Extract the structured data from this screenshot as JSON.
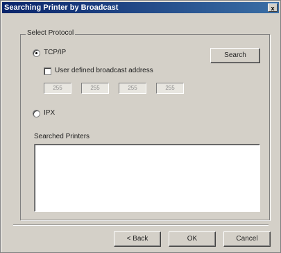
{
  "window": {
    "title": "Searching Printer by Broadcast",
    "close_glyph": "x"
  },
  "protocol_group": {
    "label": "Select Protocol",
    "tcpip": {
      "label": "TCP/IP",
      "selected": true
    },
    "user_defined": {
      "label": "User defined broadcast address",
      "checked": false
    },
    "ip_fields": [
      "255",
      "255",
      "255",
      "255"
    ],
    "ipx": {
      "label": "IPX",
      "selected": false
    }
  },
  "buttons": {
    "search": "Search",
    "back": "< Back",
    "ok": "OK",
    "cancel": "Cancel"
  },
  "results": {
    "label": "Searched Printers",
    "items": []
  }
}
